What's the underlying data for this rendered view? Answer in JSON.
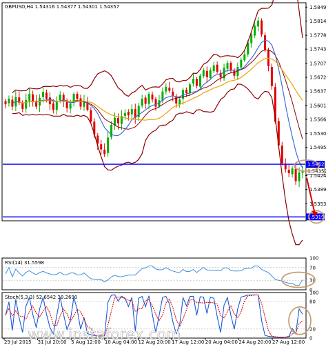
{
  "chart_data": {
    "type": "candlestick",
    "header": "GBPUSD,H4  1.54316 1.54377 1.54301 1.54357",
    "ylim": [
      1.531,
      1.586
    ],
    "price_ticks": [
      "1.58490",
      "1.58140",
      "1.57780",
      "1.57430",
      "1.57070",
      "1.56720",
      "1.56370",
      "1.56010",
      "1.55660",
      "1.55300",
      "1.54950",
      "1.54240",
      "1.53890",
      "1.53530"
    ],
    "x_ticks": [
      "29 Jul 2015",
      "31 Jul 20:00",
      "5 Aug 12:00",
      "10 Aug 04:00",
      "12 Aug 20:00",
      "17 Aug 12:00",
      "20 Aug 04:00",
      "24 Aug 20:00",
      "27 Aug 12:00"
    ],
    "levels": [
      {
        "name": "resistance",
        "value": 1.54527,
        "label": "1.54527",
        "color": "#0000ff"
      },
      {
        "name": "support",
        "value": 1.53198,
        "label": "1.53198",
        "color": "#0000ff"
      }
    ],
    "last_price": {
      "value": 1.54357,
      "label": "1.54357"
    },
    "close": [
      1.5604,
      1.5618,
      1.5598,
      1.5622,
      1.5608,
      1.5592,
      1.5615,
      1.563,
      1.5612,
      1.5598,
      1.562,
      1.5635,
      1.5618,
      1.5604,
      1.559,
      1.5612,
      1.5628,
      1.561,
      1.5594,
      1.5606,
      1.563,
      1.5618,
      1.5598,
      1.5612,
      1.559,
      1.556,
      1.5528,
      1.5505,
      1.549,
      1.5478,
      1.552,
      1.5552,
      1.557,
      1.5556,
      1.5574,
      1.5582,
      1.5576,
      1.5592,
      1.557,
      1.56,
      1.5618,
      1.5605,
      1.563,
      1.5616,
      1.5598,
      1.5614,
      1.5636,
      1.5648,
      1.5638,
      1.5625,
      1.5606,
      1.5616,
      1.564,
      1.5632,
      1.5654,
      1.5668,
      1.565,
      1.5676,
      1.569,
      1.5672,
      1.569,
      1.5702,
      1.5686,
      1.5672,
      1.5696,
      1.5708,
      1.569,
      1.5676,
      1.5698,
      1.5716,
      1.573,
      1.576,
      1.578,
      1.5802,
      1.5815,
      1.578,
      1.574,
      1.57,
      1.565,
      1.556,
      1.55,
      1.5455,
      1.544,
      1.543,
      1.5442,
      1.541,
      1.5432,
      1.54357
    ],
    "rsi": {
      "label": "RSI(14) 31.5598",
      "ylim": [
        0,
        100
      ],
      "ticks": [
        "100",
        "70",
        "30",
        "0"
      ],
      "current": 31.5598
    },
    "stochastic": {
      "label": "Stoch(5,3,3) 52.6542 38.2690",
      "ylim": [
        0,
        100
      ],
      "ticks": [
        "100",
        "80",
        "20",
        "0"
      ],
      "main": 52.6542,
      "signal": 38.269
    },
    "colors": {
      "bull": "#00b000",
      "bear": "#e00000",
      "bollinger": "#8b0000",
      "ma_blue": "#3b6fd6",
      "ma_orange": "#f2a000",
      "rsi": "#3b8fe0",
      "stoch_main": "#1a5ad6",
      "stoch_signal": "#e00000",
      "level": "#0000ff",
      "annotation": "#c8a070"
    }
  },
  "watermark": "www.instaforex.com"
}
